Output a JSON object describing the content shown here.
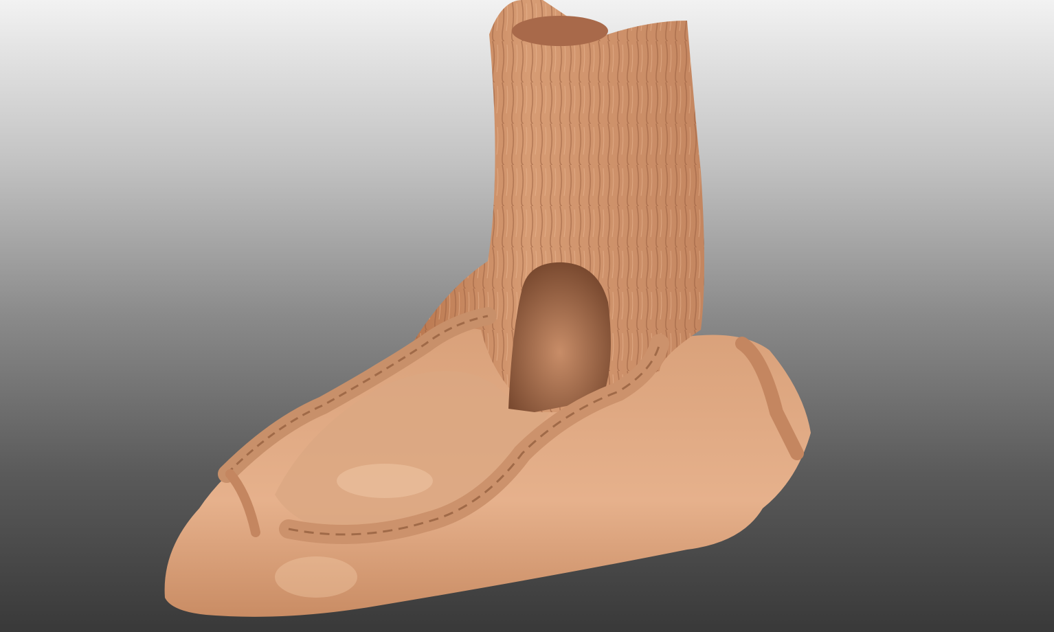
{
  "scene": {
    "subject": "tree-stump-sculpt",
    "colors": {
      "background_top": "#f2f2f2",
      "background_bottom": "#393939",
      "material_light": "#e8b48e",
      "material_mid": "#d49a72",
      "material_dark": "#8a5538"
    }
  }
}
